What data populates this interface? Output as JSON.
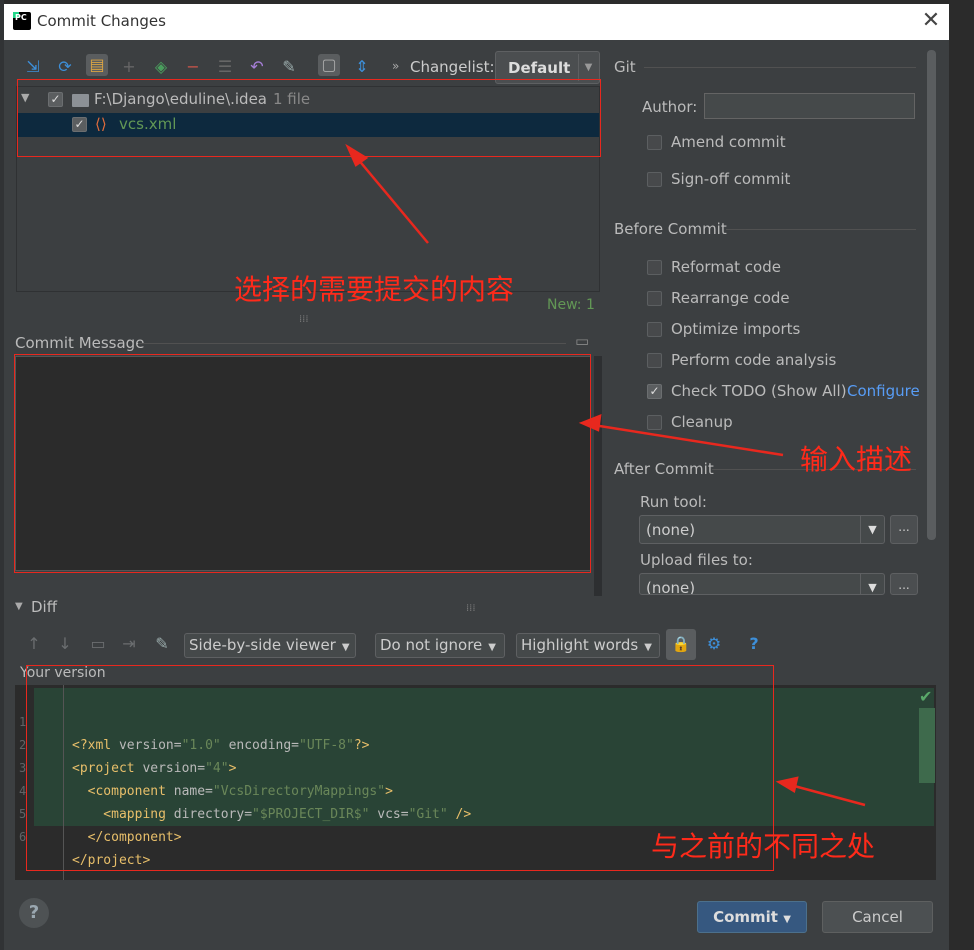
{
  "window": {
    "title": "Commit Changes",
    "app_icon_label": "PC"
  },
  "toolbar": {
    "icons": [
      "move-icon",
      "refresh-icon",
      "diff-icon",
      "add-icon",
      "shelve-icon",
      "remove-icon",
      "group-icon",
      "undo-icon",
      "edit-icon",
      "show-unversioned-icon",
      "expand-icon"
    ],
    "changelist_label": "Changelist:",
    "changelist_value": "Default"
  },
  "file_tree": {
    "root_path": "F:\\Django\\eduline\\.idea",
    "root_count": "1 file",
    "file_name": "vcs.xml",
    "new_count": "New: 1"
  },
  "commit_message": {
    "label": "Commit Message",
    "value": ""
  },
  "git": {
    "section": "Git",
    "author_label": "Author:",
    "author_value": "",
    "amend": "Amend commit",
    "signoff": "Sign-off commit"
  },
  "before_commit": {
    "section": "Before Commit",
    "options": [
      {
        "label": "Reformat code",
        "checked": false
      },
      {
        "label": "Rearrange code",
        "checked": false
      },
      {
        "label": "Optimize imports",
        "checked": false
      },
      {
        "label": "Perform code analysis",
        "checked": false
      },
      {
        "label": "Check TODO (Show All)",
        "checked": true
      },
      {
        "label": "Cleanup",
        "checked": false
      }
    ],
    "configure_link": "Configure"
  },
  "after_commit": {
    "section": "After Commit",
    "run_tool_label": "Run tool:",
    "run_tool_value": "(none)",
    "upload_label": "Upload files to:",
    "upload_value": "(none)",
    "more_button": "..."
  },
  "diff": {
    "section": "Diff",
    "viewer": "Side-by-side viewer",
    "ignore": "Do not ignore",
    "highlight": "Highlight words",
    "help": "?",
    "version_label": "Your version",
    "lines": [
      {
        "n": "1",
        "text": "<?xml version=\"1.0\" encoding=\"UTF-8\"?>"
      },
      {
        "n": "2",
        "text": "<project version=\"4\">"
      },
      {
        "n": "3",
        "text": "  <component name=\"VcsDirectoryMappings\">"
      },
      {
        "n": "4",
        "text": "    <mapping directory=\"$PROJECT_DIR$\" vcs=\"Git\" />"
      },
      {
        "n": "5",
        "text": "  </component>"
      },
      {
        "n": "6",
        "text": "</project>"
      }
    ]
  },
  "buttons": {
    "help": "?",
    "commit": "Commit",
    "cancel": "Cancel"
  },
  "annotations": {
    "files": "选择的需要提交的内容",
    "message": "输入描述",
    "diff": "与之前的不同之处",
    "color": "#e8281e"
  }
}
